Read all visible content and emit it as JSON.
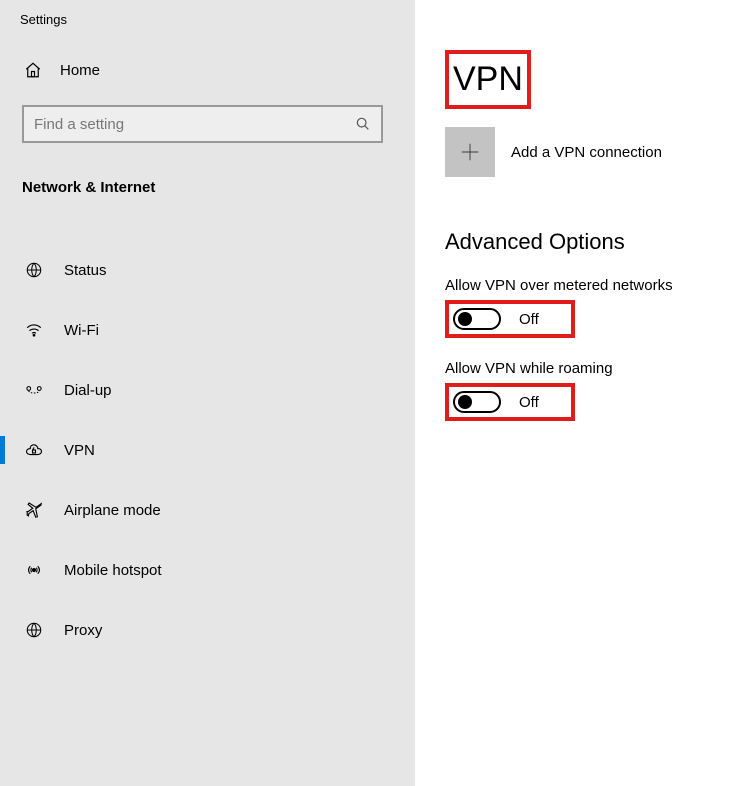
{
  "app_title": "Settings",
  "home_label": "Home",
  "search_placeholder": "Find a setting",
  "section_header": "Network & Internet",
  "nav_items": [
    {
      "label": "Status",
      "icon": "globe",
      "active": false
    },
    {
      "label": "Wi-Fi",
      "icon": "wifi",
      "active": false
    },
    {
      "label": "Dial-up",
      "icon": "dialup",
      "active": false
    },
    {
      "label": "VPN",
      "icon": "vpn",
      "active": true
    },
    {
      "label": "Airplane mode",
      "icon": "airplane",
      "active": false
    },
    {
      "label": "Mobile hotspot",
      "icon": "hotspot",
      "active": false
    },
    {
      "label": "Proxy",
      "icon": "proxy",
      "active": false
    }
  ],
  "main": {
    "heading": "VPN",
    "add_label": "Add a VPN connection",
    "advanced_heading": "Advanced Options",
    "options": [
      {
        "label": "Allow VPN over metered networks",
        "state": "Off"
      },
      {
        "label": "Allow VPN while roaming",
        "state": "Off"
      }
    ]
  }
}
